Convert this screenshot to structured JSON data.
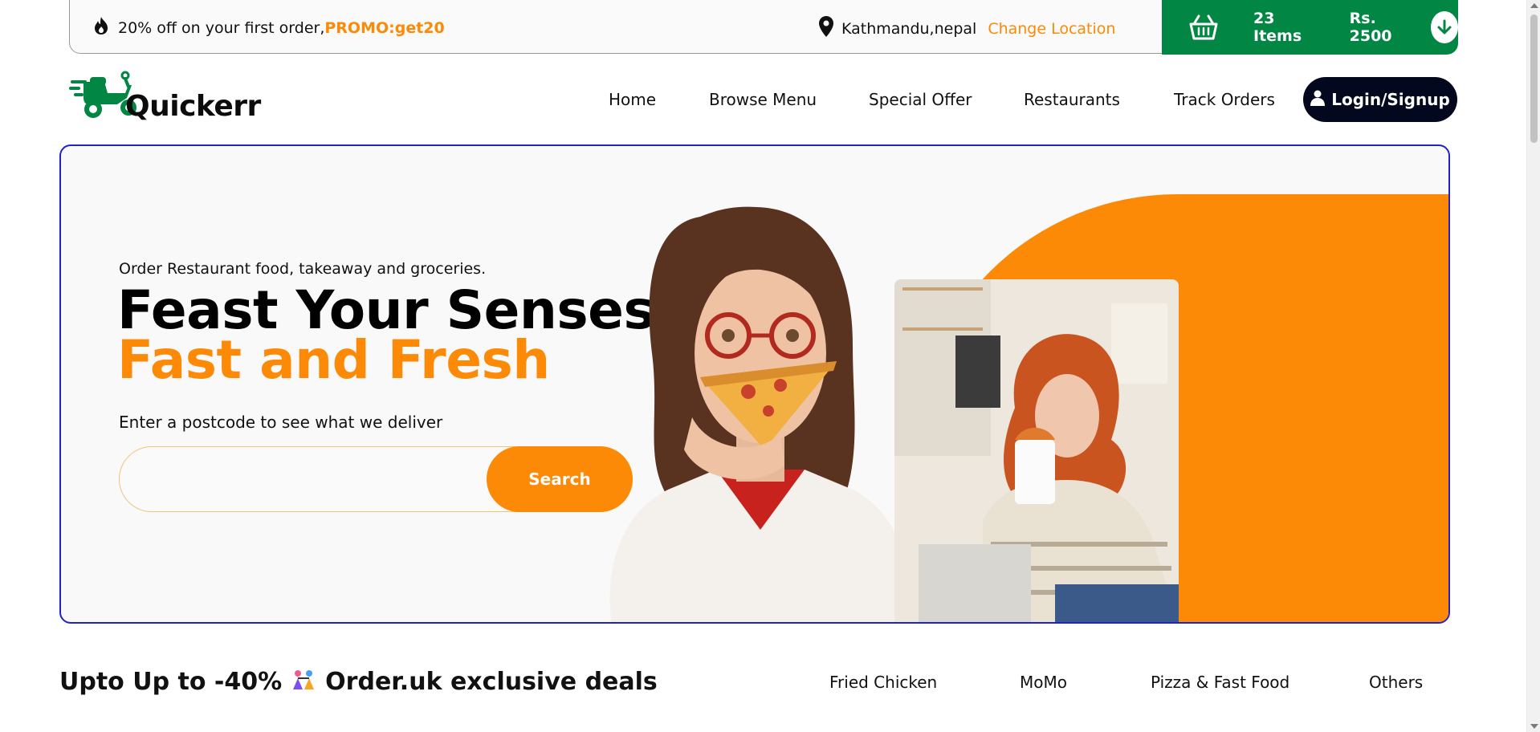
{
  "promo": {
    "text": "20% off on your first order,",
    "code": "PROMO:get20"
  },
  "location": {
    "city": "Kathmandu,nepal",
    "change_label": "Change Location"
  },
  "cart": {
    "items": "23 Items",
    "total": "Rs. 2500"
  },
  "brand": {
    "name": "Quickerr"
  },
  "nav": {
    "items": [
      "Home",
      "Browse Menu",
      "Special Offer",
      "Restaurants",
      "Track Orders"
    ],
    "login_label": "Login/Signup"
  },
  "hero": {
    "kicker": "Order Restaurant food, takeaway and groceries.",
    "title_line1": "Feast Your Senses",
    "title_line2": "Fast and Fresh",
    "lead": "Enter a postcode to see what we deliver",
    "search_placeholder": "",
    "search_button": "Search"
  },
  "deals": {
    "title_left": "Upto Up to -40%",
    "title_right": "Order.uk exclusive deals",
    "categories": [
      "Fried Chicken",
      "MoMo",
      "Pizza & Fast Food",
      "Others"
    ]
  },
  "colors": {
    "accent": "#fc8a06",
    "green": "#028643",
    "dark": "#03081f"
  }
}
